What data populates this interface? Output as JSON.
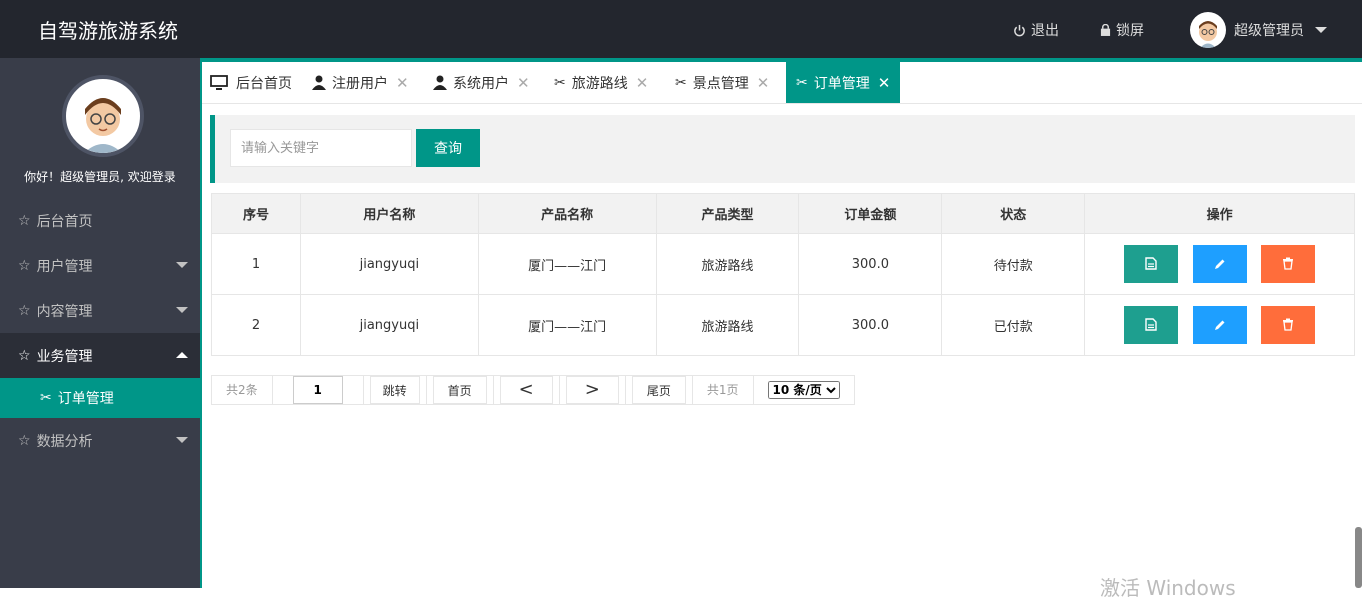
{
  "app": {
    "title": "自驾游旅游系统"
  },
  "header": {
    "logout_label": "退出",
    "lock_label": "锁屏",
    "user_label": "超级管理员"
  },
  "sidebar": {
    "greeting": "你好！超级管理员, 欢迎登录",
    "items": [
      {
        "label": "后台首页",
        "expanded": false
      },
      {
        "label": "用户管理",
        "expanded": false
      },
      {
        "label": "内容管理",
        "expanded": false
      },
      {
        "label": "业务管理",
        "expanded": true
      },
      {
        "label": "数据分析",
        "expanded": false
      }
    ],
    "subitem": {
      "label": "订单管理"
    }
  },
  "tabs": [
    {
      "label": "后台首页",
      "icon": "monitor-icon"
    },
    {
      "label": "注册用户",
      "icon": "user-icon"
    },
    {
      "label": "系统用户",
      "icon": "user-icon"
    },
    {
      "label": "旅游路线",
      "icon": "tools-icon"
    },
    {
      "label": "景点管理",
      "icon": "tools-icon"
    },
    {
      "label": "订单管理",
      "icon": "tools-icon",
      "active": true
    }
  ],
  "search": {
    "placeholder": "请输入关键字",
    "button_label": "查询"
  },
  "table": {
    "headers": [
      "序号",
      "用户名称",
      "产品名称",
      "产品类型",
      "订单金额",
      "状态",
      "操作"
    ],
    "rows": [
      [
        "1",
        "jiangyuqi",
        "厦门——江门",
        "旅游路线",
        "300.0",
        "待付款"
      ],
      [
        "2",
        "jiangyuqi",
        "厦门——江门",
        "旅游路线",
        "300.0",
        "已付款"
      ]
    ]
  },
  "pager": {
    "total": "共2条",
    "page_input": "1",
    "jump": "跳转",
    "first": "首页",
    "prev": "<",
    "next": ">",
    "last": "尾页",
    "pages": "共1页",
    "page_size": "10 条/页"
  },
  "watermark": "激活 Windows"
}
